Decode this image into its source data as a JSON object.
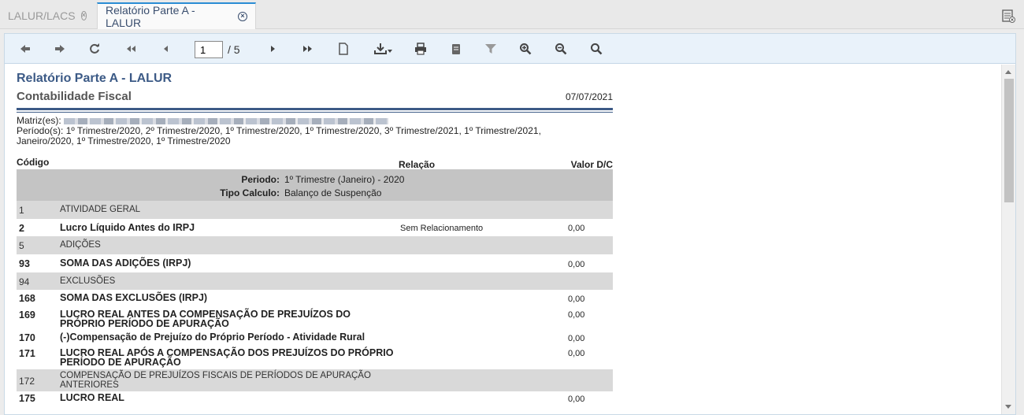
{
  "tabs": [
    {
      "label": "LALUR/LACS"
    },
    {
      "label": "Relatório Parte A - LALUR"
    }
  ],
  "toolbar": {
    "page_current": "1",
    "page_total": "/ 5",
    "icons": [
      "back-arrow-icon",
      "forward-arrow-icon",
      "refresh-icon",
      "first-page-icon",
      "previous-page-icon",
      "next-page-icon",
      "last-page-icon",
      "document-icon",
      "download-icon",
      "print-icon",
      "copy-icon",
      "filter-icon",
      "zoom-in-icon",
      "zoom-out-icon",
      "search-icon"
    ]
  },
  "report": {
    "title": "Relatório Parte A - LALUR",
    "subtitle": "Contabilidade Fiscal",
    "date": "07/07/2021",
    "matriz_label": "Matriz(es):",
    "periodos_line1": "Período(s): 1º Trimestre/2020, 2º Trimestre/2020, 1º Trimestre/2020, 1º Trimestre/2020, 3º Trimestre/2021, 1º Trimestre/2021,",
    "periodos_line2": "Janeiro/2020, 1º Trimestre/2020, 1º Trimestre/2020",
    "col_codigo": "Código",
    "col_relacao": "Relação",
    "col_valor": "Valor D/C",
    "period_label": "Periodo:",
    "period_value": "1º Trimestre (Janeiro) - 2020",
    "tipo_label": "Tipo Calculo:",
    "tipo_value": "Balanço de Suspenção",
    "rows": [
      {
        "code": "1",
        "desc": "ATIVIDADE GERAL",
        "rel": "",
        "amt": ""
      },
      {
        "code": "2",
        "desc": "Lucro Líquido Antes do IRPJ",
        "rel": "Sem Relacionamento",
        "amt": "0,00"
      },
      {
        "code": "5",
        "desc": "ADIÇÕES",
        "rel": "",
        "amt": ""
      },
      {
        "code": "93",
        "desc": "SOMA DAS ADIÇÕES (IRPJ)",
        "rel": "",
        "amt": "0,00"
      },
      {
        "code": "94",
        "desc": "EXCLUSÕES",
        "rel": "",
        "amt": ""
      },
      {
        "code": "168",
        "desc": "SOMA DAS EXCLUSÕES (IRPJ)",
        "rel": "",
        "amt": "0,00"
      },
      {
        "code": "169",
        "desc": "LUCRO REAL ANTES DA COMPENSAÇÃO DE PREJUÍZOS DO PRÓPRIO PERÍODO DE APURAÇÃO",
        "rel": "",
        "amt": "0,00"
      },
      {
        "code": "170",
        "desc": "(-)Compensação de Prejuízo do Próprio Período - Atividade Rural",
        "rel": "",
        "amt": "0,00"
      },
      {
        "code": "171",
        "desc": "LUCRO REAL APÓS A COMPENSAÇÃO DOS PREJUÍZOS DO PRÓPRIO PERÍODO DE APURAÇÃO",
        "rel": "",
        "amt": "0,00"
      },
      {
        "code": "172",
        "desc": "COMPENSAÇÃO DE PREJUÍZOS FISCAIS DE PERÍODOS DE APURAÇÃO ANTERIORES",
        "rel": "",
        "amt": ""
      },
      {
        "code": "175",
        "desc": "LUCRO REAL",
        "rel": "",
        "amt": "0,00"
      }
    ]
  }
}
